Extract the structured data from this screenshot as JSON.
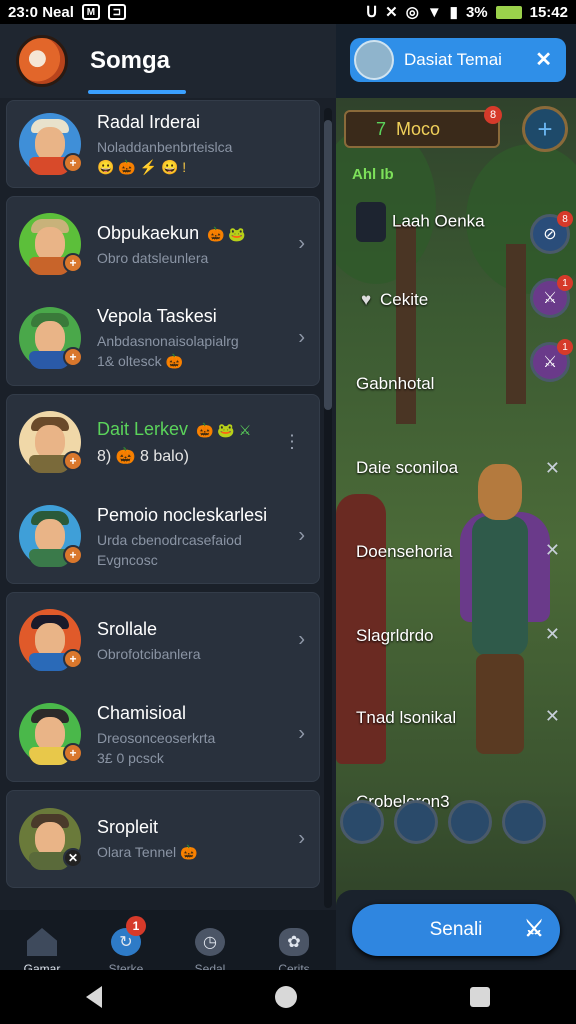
{
  "status_bar": {
    "time": "23:0 Neal",
    "right_text": "3% ",
    "clock": "15:42"
  },
  "header": {
    "title": "Somga"
  },
  "conversations": [
    {
      "name": "Radal Irderai",
      "sub": "Noladdanbenbrteislca",
      "emojis": "😀 🎃 ⚡ 😀 !"
    },
    {
      "name": "Obpukaekun",
      "name_emoji": "🎃 🐸",
      "sub": "Obro datsleunlera"
    },
    {
      "name": "Vepola Taskesi",
      "sub": "Anbdasnonaisolapialrg",
      "sub2": "1& oltesck 🎃"
    },
    {
      "name": "Dait Lerkev",
      "name_emoji": "🎃 🐸 ⚔",
      "sub": "8) 🎃 8 balo)"
    },
    {
      "name": "Pemoio nocleskarlesi",
      "sub": "Urda cbenodrcasefaiod",
      "sub2": "Evgncosc"
    },
    {
      "name": "Srollale",
      "sub": "Obrofotcibanlera"
    },
    {
      "name": "Chamisioal",
      "sub": "Dreosonceoserkrta",
      "sub2": "3£ 0 pcsck"
    },
    {
      "name": "Sropleit",
      "sub": "Olara Tennel 🎃"
    }
  ],
  "bottom_nav": [
    {
      "label": "Gamar",
      "icon": "home-icon"
    },
    {
      "label": "Sterke",
      "icon": "chat-icon",
      "badge": "1"
    },
    {
      "label": "Sedal",
      "icon": "clock-icon"
    },
    {
      "label": "Cerits",
      "icon": "settings-icon"
    }
  ],
  "game": {
    "pill_label": "Dasiat Temai",
    "resource_value": "7",
    "resource_label": "Moco",
    "resource_badge": "8",
    "level_label": "Ahl Ib",
    "items": [
      {
        "label": "Laah Oenka"
      },
      {
        "label": "Cekite"
      },
      {
        "label": "Gabnhotal"
      },
      {
        "label": "Daie sconiloa"
      },
      {
        "label": "Doensehoria"
      },
      {
        "label": "Slagrldrdo"
      },
      {
        "label": "Tnad lsonikal"
      },
      {
        "label": "Crobeloron3"
      }
    ],
    "side_badges": [
      "8",
      "1",
      "1"
    ],
    "action_button": "Senali"
  },
  "colors": {
    "accent": "#3aa0ff",
    "panel": "#29313d",
    "badge": "#d63a2a",
    "action": "#2f86e0"
  }
}
